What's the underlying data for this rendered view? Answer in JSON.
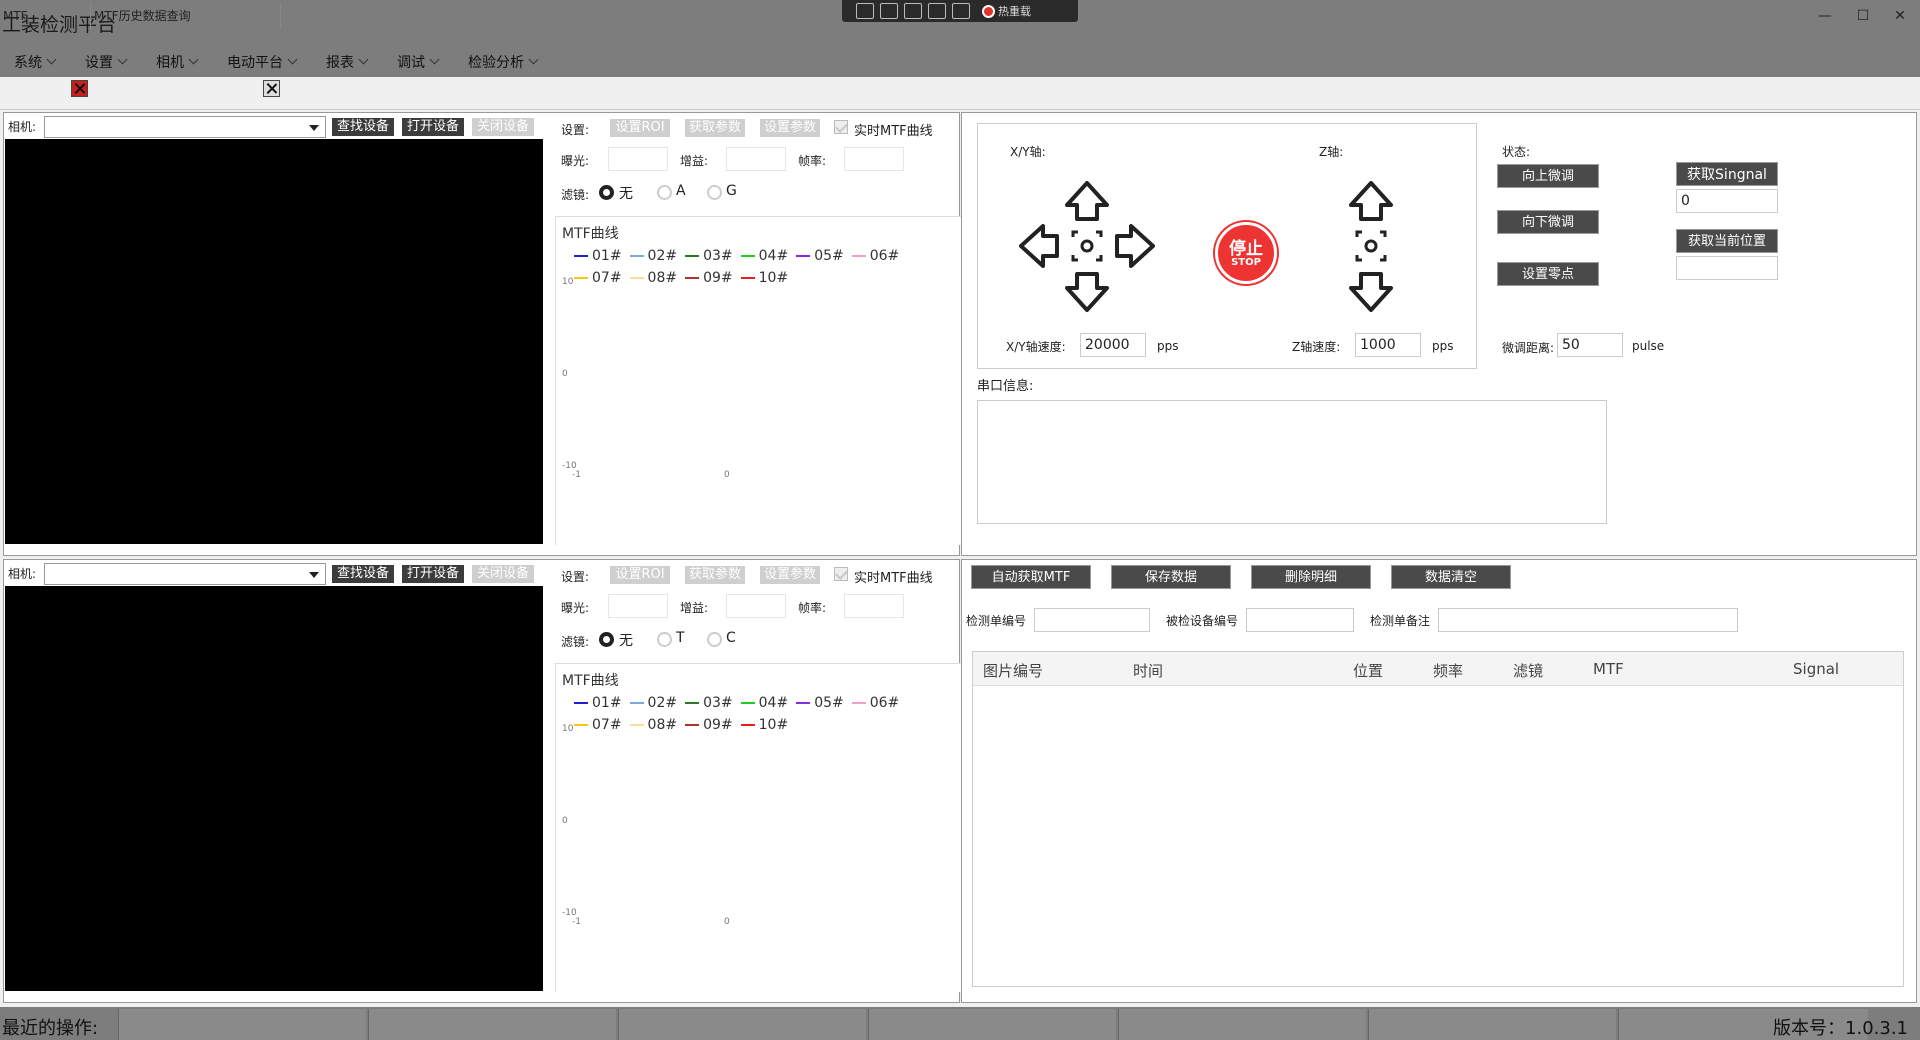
{
  "window": {
    "title": "工装检测平台",
    "minimize": "—",
    "maximize": "☐",
    "close": "✕",
    "devbar_hotreload": "热重载"
  },
  "menu": [
    {
      "label": "系统"
    },
    {
      "label": "设置"
    },
    {
      "label": "相机"
    },
    {
      "label": "电动平台"
    },
    {
      "label": "报表"
    },
    {
      "label": "调试"
    },
    {
      "label": "检验分析"
    }
  ],
  "tabs": [
    {
      "label": "MTF"
    },
    {
      "label": "MTF历史数据查询"
    }
  ],
  "camera_panels": [
    {
      "camera_label": "相机:",
      "find_btn": "查找设备",
      "open_btn": "打开设备",
      "close_btn": "关闭设备",
      "settings_label": "设置:",
      "roi_btn": "设置ROI",
      "get_params_btn": "获取参数",
      "set_params_btn": "设置参数",
      "realtime_label": "实时MTF曲线",
      "exposure_label": "曝光:",
      "gain_label": "增益:",
      "framerate_label": "帧率:",
      "filter_label": "滤镜:",
      "filters": [
        "无",
        "A",
        "G"
      ],
      "chart_title": "MTF曲线"
    },
    {
      "camera_label": "相机:",
      "find_btn": "查找设备",
      "open_btn": "打开设备",
      "close_btn": "关闭设备",
      "settings_label": "设置:",
      "roi_btn": "设置ROI",
      "get_params_btn": "获取参数",
      "set_params_btn": "设置参数",
      "realtime_label": "实时MTF曲线",
      "exposure_label": "曝光:",
      "gain_label": "增益:",
      "framerate_label": "帧率:",
      "filter_label": "滤镜:",
      "filters": [
        "无",
        "T",
        "C"
      ],
      "chart_title": "MTF曲线"
    }
  ],
  "chart_data": [
    {
      "type": "line",
      "title": "MTF曲线",
      "series": [
        {
          "name": "01#",
          "color": "#1f1fd6"
        },
        {
          "name": "02#",
          "color": "#7fa7e0"
        },
        {
          "name": "03#",
          "color": "#2a7a2a"
        },
        {
          "name": "04#",
          "color": "#22cc22"
        },
        {
          "name": "05#",
          "color": "#8a2be2"
        },
        {
          "name": "06#",
          "color": "#f0a0c8"
        },
        {
          "name": "07#",
          "color": "#f5c518"
        },
        {
          "name": "08#",
          "color": "#f5e0a0"
        },
        {
          "name": "09#",
          "color": "#b03030"
        },
        {
          "name": "10#",
          "color": "#e61e1e"
        }
      ],
      "y_ticks": [
        "10",
        "0",
        "-10"
      ],
      "x_ticks": [
        "-1",
        "0"
      ],
      "ylim": [
        -10,
        10
      ]
    },
    {
      "type": "line",
      "title": "MTF曲线",
      "series": [
        {
          "name": "01#",
          "color": "#1f1fd6"
        },
        {
          "name": "02#",
          "color": "#7fa7e0"
        },
        {
          "name": "03#",
          "color": "#2a7a2a"
        },
        {
          "name": "04#",
          "color": "#22cc22"
        },
        {
          "name": "05#",
          "color": "#8a2be2"
        },
        {
          "name": "06#",
          "color": "#f0a0c8"
        },
        {
          "name": "07#",
          "color": "#f5c518"
        },
        {
          "name": "08#",
          "color": "#f5e0a0"
        },
        {
          "name": "09#",
          "color": "#b03030"
        },
        {
          "name": "10#",
          "color": "#e61e1e"
        }
      ],
      "y_ticks": [
        "10",
        "0",
        "-10"
      ],
      "x_ticks": [
        "-1",
        "0"
      ],
      "ylim": [
        -10,
        10
      ]
    }
  ],
  "motion": {
    "xy_axis_label": "X/Y轴:",
    "z_axis_label": "Z轴:",
    "stop_text": "停止",
    "stop_sub": "STOP",
    "xy_speed_label": "X/Y轴速度:",
    "xy_speed_value": "20000",
    "xy_speed_unit": "pps",
    "z_speed_label": "Z轴速度:",
    "z_speed_value": "1000",
    "z_speed_unit": "pps",
    "status_label": "状态:",
    "up_adjust_btn": "向上微调",
    "down_adjust_btn": "向下微调",
    "zero_btn": "设置零点",
    "get_signal_btn": "获取Singnal",
    "signal_value": "0",
    "get_position_btn": "获取当前位置",
    "position_value": "",
    "fine_distance_label": "微调距离:",
    "fine_distance_value": "50",
    "fine_distance_unit": "pulse",
    "serial_label": "串口信息:"
  },
  "data_panel": {
    "auto_mtf_btn": "自动获取MTF",
    "save_btn": "保存数据",
    "delete_btn": "删除明细",
    "clear_btn": "数据清空",
    "order_no_label": "检测单编号",
    "device_no_label": "被检设备编号",
    "remark_label": "检测单备注",
    "columns": [
      "图片编号",
      "时间",
      "位置",
      "频率",
      "滤镜",
      "MTF",
      "Signal"
    ]
  },
  "status": {
    "recent_label": "最近的操作:",
    "version_label": "版本号：1.0.3.1"
  }
}
